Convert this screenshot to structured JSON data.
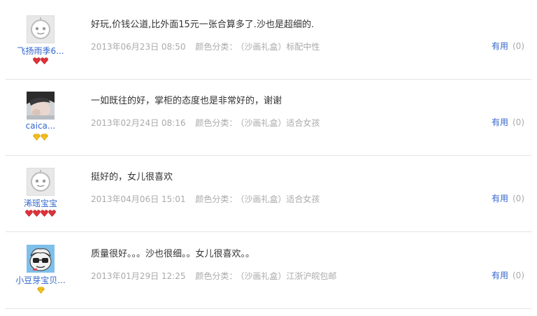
{
  "reviews": [
    {
      "username": "飞扬雨季6...",
      "avatar": "default-avatar",
      "badge_type": "red-heart",
      "badge_count": 2,
      "comment": "好玩,价钱公道,比外面15元一张合算多了.沙也是超细的.",
      "date": "2013年06月23日 08:50",
      "color_label": "颜色分类：",
      "color_value": "（沙画礼盒）标配中性",
      "helpful_label": "有用",
      "helpful_count": "(0)"
    },
    {
      "username": "caica...",
      "avatar": "photo-avatar",
      "badge_type": "yellow-diamond",
      "badge_count": 2,
      "comment": "一如既往的好，掌柜的态度也是非常好的，谢谢",
      "date": "2013年02月24日 08:16",
      "color_label": "颜色分类：",
      "color_value": "（沙画礼盒）适合女孩",
      "helpful_label": "有用",
      "helpful_count": "(0)"
    },
    {
      "username": "浠瑶宝宝",
      "avatar": "default-avatar",
      "badge_type": "red-heart",
      "badge_count": 4,
      "comment": "挺好的，女儿很喜欢",
      "date": "2013年04月06日 15:01",
      "color_label": "颜色分类：",
      "color_value": "（沙画礼盒）适合女孩",
      "helpful_label": "有用",
      "helpful_count": "(0)"
    },
    {
      "username": "小豆芽宝贝...",
      "avatar": "cartoon-avatar",
      "badge_type": "yellow-diamond",
      "badge_count": 1,
      "comment": "质量很好。。。沙也很细。。女儿很喜欢。。",
      "date": "2013年01月29日 12:25",
      "color_label": "颜色分类：",
      "color_value": "（沙画礼盒）江浙沪皖包邮",
      "helpful_label": "有用",
      "helpful_count": "(0)"
    }
  ]
}
